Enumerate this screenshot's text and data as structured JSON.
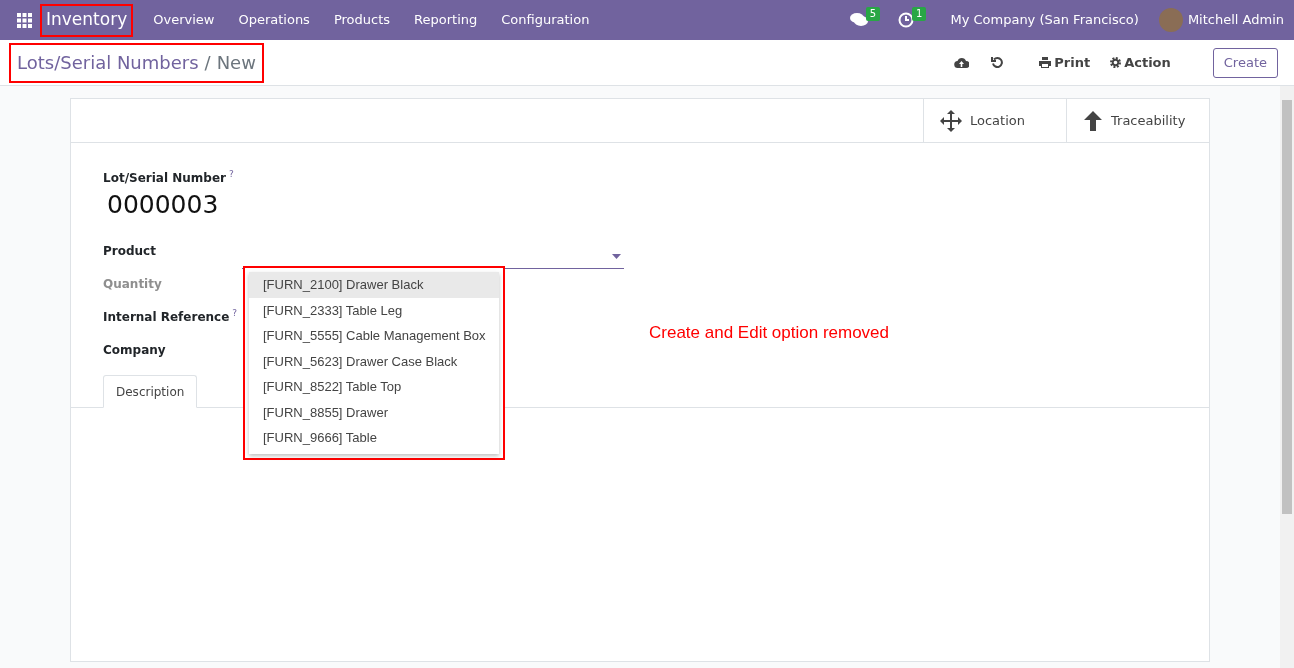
{
  "navbar": {
    "app_name": "Inventory",
    "app_name_highlighted": true,
    "menu": [
      "Overview",
      "Operations",
      "Products",
      "Reporting",
      "Configuration"
    ],
    "messages_count": "5",
    "activities_count": "1",
    "company": "My Company (San Francisco)",
    "user": "Mitchell Admin"
  },
  "breadcrumb": {
    "parent": "Lots/Serial Numbers",
    "separator": "/",
    "current": "New",
    "highlighted": true
  },
  "toolbar": {
    "print": "Print",
    "action": "Action",
    "create": "Create"
  },
  "smart_buttons": [
    {
      "label": "Location",
      "kind": "move"
    },
    {
      "label": "Traceability",
      "kind": "up"
    }
  ],
  "form": {
    "title_label": "Lot/Serial Number",
    "title_help": "?",
    "title_value": "0000003",
    "fields": [
      {
        "label": "Product",
        "kind": "dropdown",
        "muted": false
      },
      {
        "label": "Quantity",
        "kind": "text",
        "muted": true
      },
      {
        "label": "Internal Reference",
        "help": "?",
        "kind": "text",
        "muted": false
      },
      {
        "label": "Company",
        "kind": "text",
        "muted": false
      }
    ]
  },
  "tabs": [
    {
      "label": "Description",
      "selected": true
    }
  ],
  "dropdown": {
    "highlighted": true,
    "options": [
      {
        "label": "[FURN_2100] Drawer Black",
        "selected": true
      },
      {
        "label": "[FURN_2333] Table Leg",
        "selected": false
      },
      {
        "label": "[FURN_5555] Cable Management Box",
        "selected": false
      },
      {
        "label": "[FURN_5623] Drawer Case Black",
        "selected": false
      },
      {
        "label": "[FURN_8522] Table Top",
        "selected": false
      },
      {
        "label": "[FURN_8855] Drawer",
        "selected": false
      },
      {
        "label": "[FURN_9666] Table",
        "selected": false
      }
    ]
  },
  "annotation": "Create and Edit option removed"
}
